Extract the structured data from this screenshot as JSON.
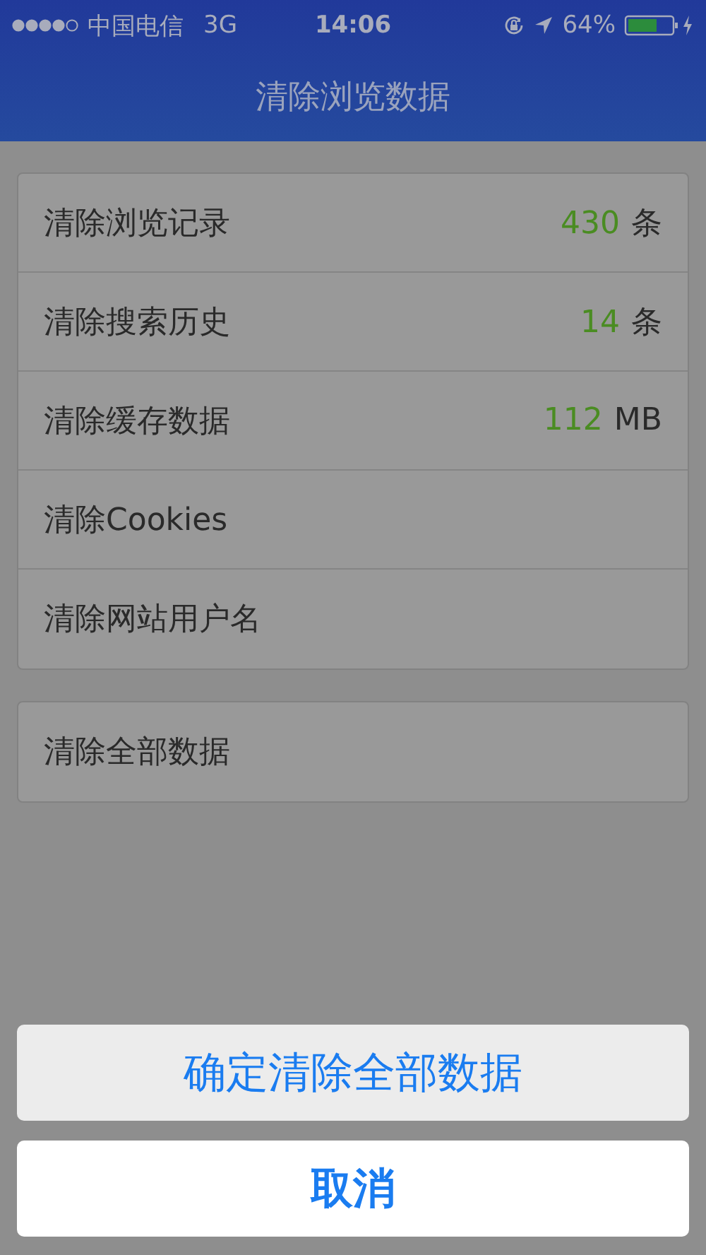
{
  "status_bar": {
    "carrier": "中国电信",
    "network": "3G",
    "time": "14:06",
    "battery": "64%"
  },
  "nav": {
    "title": "清除浏览数据"
  },
  "groups": [
    {
      "rows": [
        {
          "label": "清除浏览记录",
          "count": "430",
          "unit": "条"
        },
        {
          "label": "清除搜索历史",
          "count": "14",
          "unit": "条"
        },
        {
          "label": "清除缓存数据",
          "count": "112",
          "unit": "MB"
        },
        {
          "label": "清除Cookies"
        },
        {
          "label": "清除网站用户名"
        }
      ]
    },
    {
      "rows": [
        {
          "label": "清除全部数据"
        }
      ]
    }
  ],
  "action_sheet": {
    "buttons": [
      {
        "label": "确定清除全部数据",
        "kind": "action"
      },
      {
        "label": "取消",
        "kind": "cancel"
      }
    ]
  }
}
